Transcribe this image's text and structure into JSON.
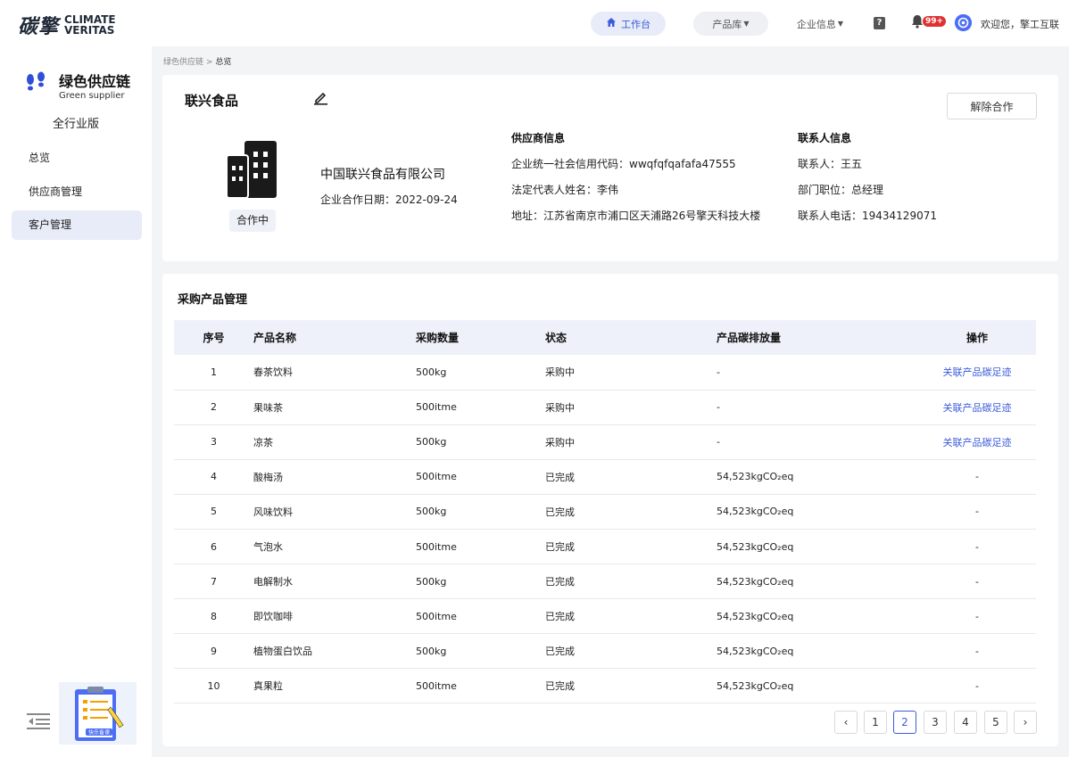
{
  "header": {
    "logo_cn": "碳擎",
    "logo_en_line1": "CLIMATE",
    "logo_en_line2": "VERITAS",
    "nav_workbench": "工作台",
    "nav_product": "产品库",
    "nav_enterprise": "企业信息",
    "help": "?",
    "notification_badge": "99+",
    "welcome": "欢迎您，擎工互联"
  },
  "sidebar": {
    "title": "绿色供应链",
    "subtitle": "Green supplier",
    "edition": "全行业版",
    "items": [
      {
        "label": "总览",
        "active": false
      },
      {
        "label": "供应商管理",
        "active": false
      },
      {
        "label": "客户管理",
        "active": true
      }
    ],
    "clipboard_text": "快乐备课"
  },
  "breadcrumb": {
    "parent": "绿色供应链",
    "separator": ">",
    "current": "总览"
  },
  "supplier": {
    "short_name": "联兴食品",
    "end_cooperation": "解除合作",
    "status": "合作中",
    "full_name": "中国联兴食品有限公司",
    "coop_date": "企业合作日期：2022-09-24",
    "info_title": "供应商信息",
    "credit_code": "企业统一社会信用代码：wwqfqfqafafa47555",
    "legal_rep": "法定代表人姓名：李伟",
    "address": "地址：江苏省南京市浦口区天浦路26号擎天科技大楼",
    "contact_title": "联系人信息",
    "contact_name": "联系人：王五",
    "contact_position": "部门职位：总经理",
    "contact_phone": "联系人电话：19434129071"
  },
  "table": {
    "title": "采购产品管理",
    "columns": [
      "序号",
      "产品名称",
      "采购数量",
      "状态",
      "产品碳排放量",
      "操作"
    ],
    "rows": [
      {
        "idx": "1",
        "name": "春茶饮料",
        "qty": "500kg",
        "status": "采购中",
        "carbon": "-",
        "op": "关联产品碳足迹",
        "op_link": true
      },
      {
        "idx": "2",
        "name": "果味茶",
        "qty": "500itme",
        "status": "采购中",
        "carbon": "-",
        "op": "关联产品碳足迹",
        "op_link": true
      },
      {
        "idx": "3",
        "name": "凉茶",
        "qty": "500kg",
        "status": "采购中",
        "carbon": "-",
        "op": "关联产品碳足迹",
        "op_link": true
      },
      {
        "idx": "4",
        "name": "酸梅汤",
        "qty": "500itme",
        "status": "已完成",
        "carbon": "54,523kgCO₂eq",
        "op": "-",
        "op_link": false
      },
      {
        "idx": "5",
        "name": "风味饮料",
        "qty": "500kg",
        "status": "已完成",
        "carbon": "54,523kgCO₂eq",
        "op": "-",
        "op_link": false
      },
      {
        "idx": "6",
        "name": "气泡水",
        "qty": "500itme",
        "status": "已完成",
        "carbon": "54,523kgCO₂eq",
        "op": "-",
        "op_link": false
      },
      {
        "idx": "7",
        "name": "电解制水",
        "qty": "500kg",
        "status": "已完成",
        "carbon": "54,523kgCO₂eq",
        "op": "-",
        "op_link": false
      },
      {
        "idx": "8",
        "name": "即饮咖啡",
        "qty": "500itme",
        "status": "已完成",
        "carbon": "54,523kgCO₂eq",
        "op": "-",
        "op_link": false
      },
      {
        "idx": "9",
        "name": "植物蛋白饮品",
        "qty": "500kg",
        "status": "已完成",
        "carbon": "54,523kgCO₂eq",
        "op": "-",
        "op_link": false
      },
      {
        "idx": "10",
        "name": "真果粒",
        "qty": "500itme",
        "status": "已完成",
        "carbon": "54,523kgCO₂eq",
        "op": "-",
        "op_link": false
      }
    ]
  },
  "pagination": {
    "prev": "‹",
    "next": "›",
    "pages": [
      "1",
      "2",
      "3",
      "4",
      "5"
    ],
    "current": "2"
  },
  "colors": {
    "accent": "#3b5bdb",
    "active_bg": "#e8ecf8",
    "badge": "#e03131"
  }
}
